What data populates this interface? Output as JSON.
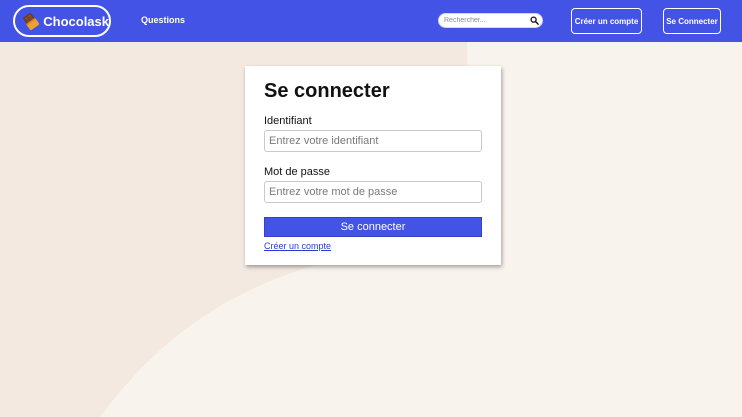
{
  "navbar": {
    "brand_name": "Chocolask",
    "logo_icon": "chocolate-bar-icon",
    "questions_label": "Questions",
    "search_placeholder": "Rechercher...",
    "search_icon": "search-icon",
    "signup_label": "Créer un compte",
    "login_label": "Se Connecter"
  },
  "login_form": {
    "title": "Se connecter",
    "username_label": "Identifiant",
    "username_placeholder": "Entrez votre identifiant",
    "password_label": "Mot de passe",
    "password_placeholder": "Entrez votre mot de passe",
    "submit_label": "Se connecter",
    "signup_link": "Créer un compte"
  },
  "colors": {
    "primary": "#4353e6",
    "background": "#f3e9e0",
    "background_light": "#f9f3ee"
  }
}
